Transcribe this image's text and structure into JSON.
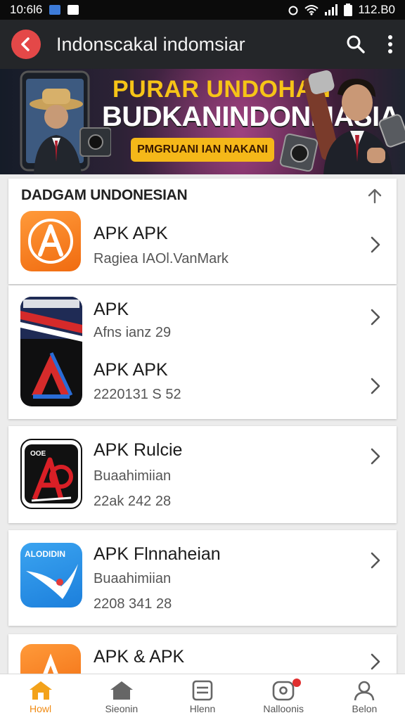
{
  "status": {
    "time": "10:6l6",
    "battery": "112.B0"
  },
  "appbar": {
    "title": "Indonscakal indomsiar",
    "back_icon": "back-arrow-icon",
    "search_icon": "search-icon",
    "menu_icon": "more-vert-icon"
  },
  "banner": {
    "line1": "PURAR UNDOHAN",
    "line2": "BUDKANINDONMASIA",
    "cta": "PMGRUANI IAN NAKANI"
  },
  "section": {
    "title": "DADGAM UNDONESIAN"
  },
  "rows": [
    {
      "title": "APK APK",
      "sub": "Ragiea IAOl.VanMark"
    },
    {
      "title": "APK",
      "sub": "Afns ianz 29"
    },
    {
      "title": "APK APK",
      "sub": "2220131 S 52"
    },
    {
      "title": "APK Rulcie",
      "sub": "Buaahimiian",
      "sub2": "22ak 242 28"
    },
    {
      "title": "APK Flnnaheian",
      "sub": "Buaahimiian",
      "sub2": "2208 341 28"
    },
    {
      "title": "APK & APK",
      "sub": ""
    }
  ],
  "icons": {
    "icon5_text": "ALODIDIN",
    "icon3_text": "OOE"
  },
  "nav": [
    {
      "label": "Howl",
      "icon": "home-icon"
    },
    {
      "label": "Sieonin",
      "icon": "store-icon"
    },
    {
      "label": "Hlenn",
      "icon": "list-icon"
    },
    {
      "label": "Nalloonis",
      "icon": "notification-icon"
    },
    {
      "label": "Belon",
      "icon": "profile-icon"
    }
  ],
  "colors": {
    "accent": "#f08a12",
    "appbar": "#242629",
    "back": "#e44848",
    "banner_text": "#f6c417"
  }
}
